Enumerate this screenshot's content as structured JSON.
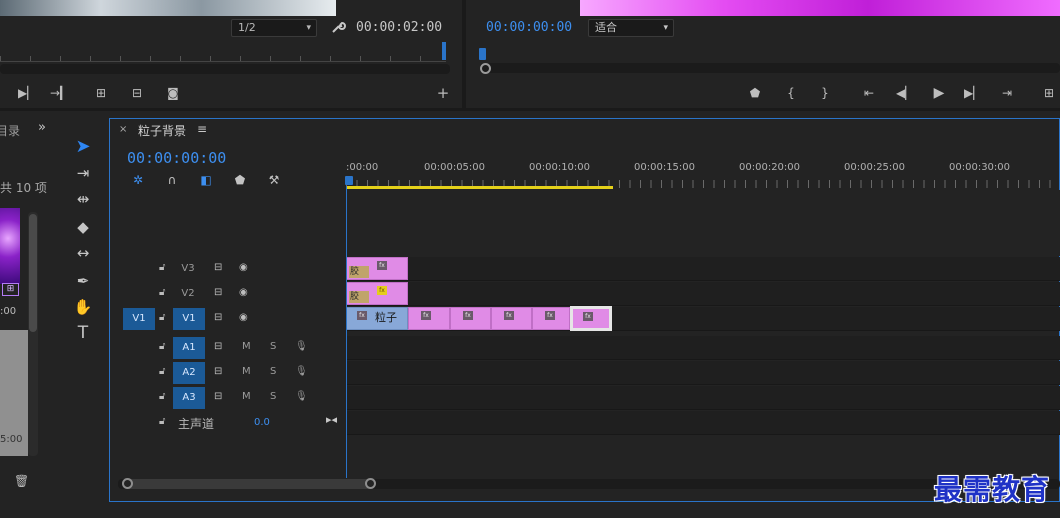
{
  "source_monitor": {
    "resolution": "1/2",
    "timecode": "00:00:02:00"
  },
  "program_monitor": {
    "timecode": "00:00:00:00",
    "fit": "适合"
  },
  "project": {
    "tab_label": "目录",
    "count_label": "共 10 项",
    "duration_1": ":00",
    "duration_2": "5:00"
  },
  "timeline": {
    "sequence_name": "粒子背景",
    "timecode": "00:00:00:00",
    "ruler_labels": [
      ":00:00",
      "00:00:05:00",
      "00:00:10:00",
      "00:00:15:00",
      "00:00:20:00",
      "00:00:25:00",
      "00:00:30:00"
    ],
    "video_tracks": [
      {
        "name": "V3",
        "active": false,
        "source": ""
      },
      {
        "name": "V2",
        "active": false,
        "source": ""
      },
      {
        "name": "V1",
        "active": true,
        "source": "V1"
      }
    ],
    "audio_tracks": [
      {
        "name": "A1",
        "m": "M",
        "s": "S"
      },
      {
        "name": "A2",
        "m": "M",
        "s": "S"
      },
      {
        "name": "A3",
        "m": "M",
        "s": "S"
      }
    ],
    "master": {
      "label": "主声道",
      "value": "0.0"
    },
    "clips": {
      "v3_label": "胶",
      "v2_label": "胶",
      "v1_label": "粒子"
    }
  },
  "watermark": "最需教育",
  "colors": {
    "accent": "#2a74c9",
    "clip": "#e08be6",
    "work_area": "#e5d11a",
    "timecode": "#3d8ff0"
  }
}
